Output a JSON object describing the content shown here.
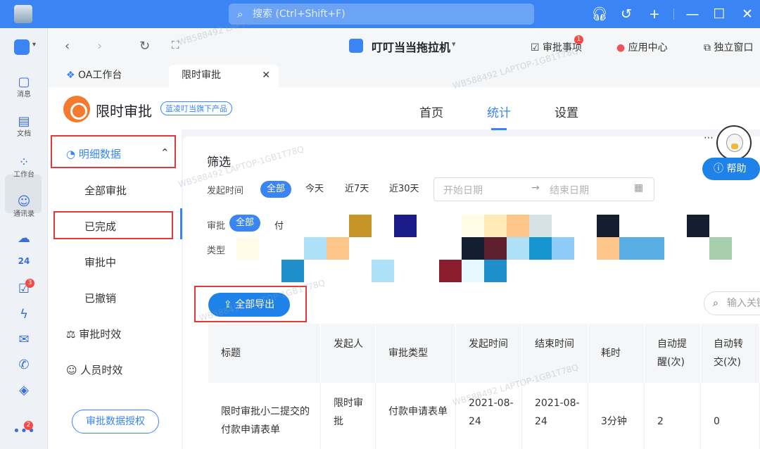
{
  "titlebar": {
    "search_placeholder": "搜索 (Ctrl+Shift+F)"
  },
  "leftbar": {
    "items": [
      {
        "label": "消息",
        "icon": "message-icon"
      },
      {
        "label": "文档",
        "icon": "document-icon"
      },
      {
        "label": "工作台",
        "icon": "workbench-icon"
      },
      {
        "label": "通讯录",
        "icon": "contacts-icon"
      },
      {
        "label": "",
        "icon": "cloud-icon"
      },
      {
        "label": "",
        "icon": "calendar-icon",
        "text": "24"
      },
      {
        "label": "",
        "icon": "todo-icon",
        "badge": "3"
      },
      {
        "label": "",
        "icon": "lightning-icon"
      },
      {
        "label": "",
        "icon": "mail-icon"
      },
      {
        "label": "",
        "icon": "phone-icon"
      },
      {
        "label": "",
        "icon": "ding-icon"
      },
      {
        "label": "",
        "icon": "more-icon",
        "badge": "2"
      }
    ]
  },
  "navbar": {
    "app_title": "叮叮当当拖拉机",
    "approval_link": "审批事项",
    "approval_badge": "1",
    "app_center": "应用中心",
    "standalone": "独立窗口"
  },
  "tabs": [
    {
      "label": "OA工作台"
    },
    {
      "label": "限时审批"
    }
  ],
  "app": {
    "name": "限时审批",
    "badge": "蓝凌叮当旗下产品",
    "header_tabs": [
      "首页",
      "统计",
      "设置"
    ],
    "active_tab": "统计"
  },
  "sidebar": {
    "section": "明细数据",
    "items": [
      "全部审批",
      "已完成",
      "审批中",
      "已撤销"
    ],
    "efficiency": "审批时效",
    "people": "人员时效",
    "auth_button": "审批数据授权"
  },
  "filter": {
    "title": "筛选",
    "time_label": "发起时间",
    "time_options": [
      "全部",
      "今天",
      "近7天",
      "近30天"
    ],
    "start_placeholder": "开始日期",
    "end_placeholder": "结束日期",
    "type_label_1": "审批",
    "type_label_2": "类型",
    "type_all": "全部",
    "type_partial": "付"
  },
  "export_button": "全部导出",
  "search_placeholder": "输入关键",
  "help_button": "帮助",
  "table": {
    "headers": [
      "标题",
      "发起人",
      "审批类型",
      "发起时间",
      "结束时间",
      "耗时",
      "自动提醒(次)",
      "自动转交(次)"
    ],
    "row": [
      "限时审批小二提交的付款申请表单",
      "限时审批",
      "付款申请表单",
      "2021-08-24",
      "2021-08-24",
      "3分钟",
      "2",
      "0"
    ]
  },
  "watermark": "WB588492 LAPTOP-1GB1T78Q",
  "colors": {
    "accent": "#3a85f3",
    "highlight_box": "#e23a3a"
  }
}
